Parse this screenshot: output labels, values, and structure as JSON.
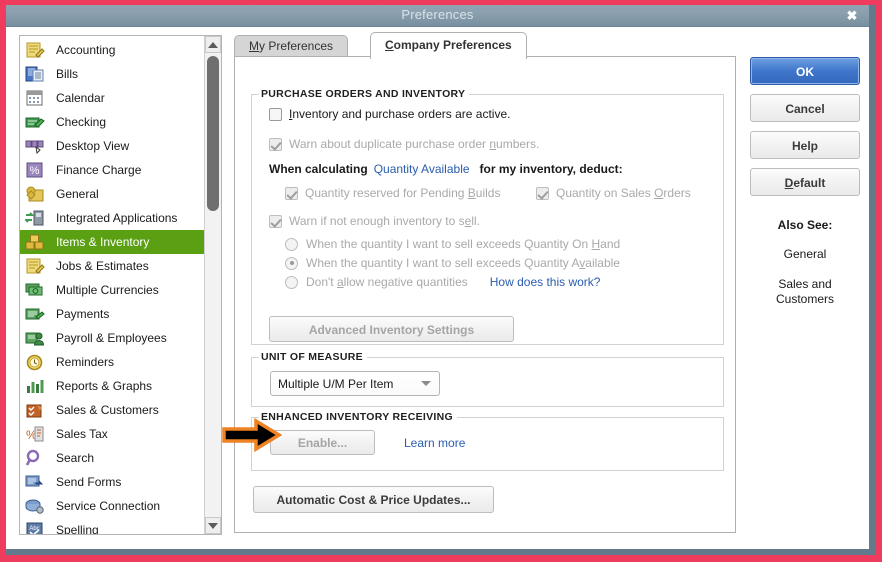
{
  "window": {
    "title": "Preferences",
    "close_label": "✖",
    "border_color": "#ef3b5e",
    "inner_border_color": "#63798c",
    "titlebar_color": "#8ba0af"
  },
  "sidebar": {
    "items": [
      {
        "label": "Accounting",
        "icon": "accounting-icon",
        "selected": false
      },
      {
        "label": "Bills",
        "icon": "bills-icon",
        "selected": false
      },
      {
        "label": "Calendar",
        "icon": "calendar-icon",
        "selected": false
      },
      {
        "label": "Checking",
        "icon": "checking-icon",
        "selected": false
      },
      {
        "label": "Desktop View",
        "icon": "desktop-view-icon",
        "selected": false
      },
      {
        "label": "Finance Charge",
        "icon": "finance-charge-icon",
        "selected": false
      },
      {
        "label": "General",
        "icon": "general-icon",
        "selected": false
      },
      {
        "label": "Integrated Applications",
        "icon": "integrated-applications-icon",
        "selected": false
      },
      {
        "label": "Items & Inventory",
        "icon": "items-inventory-icon",
        "selected": true
      },
      {
        "label": "Jobs & Estimates",
        "icon": "jobs-estimates-icon",
        "selected": false
      },
      {
        "label": "Multiple Currencies",
        "icon": "multiple-currencies-icon",
        "selected": false
      },
      {
        "label": "Payments",
        "icon": "payments-icon",
        "selected": false
      },
      {
        "label": "Payroll & Employees",
        "icon": "payroll-employees-icon",
        "selected": false
      },
      {
        "label": "Reminders",
        "icon": "reminders-icon",
        "selected": false
      },
      {
        "label": "Reports & Graphs",
        "icon": "reports-graphs-icon",
        "selected": false
      },
      {
        "label": "Sales & Customers",
        "icon": "sales-customers-icon",
        "selected": false
      },
      {
        "label": "Sales Tax",
        "icon": "sales-tax-icon",
        "selected": false
      },
      {
        "label": "Search",
        "icon": "search-icon",
        "selected": false
      },
      {
        "label": "Send Forms",
        "icon": "send-forms-icon",
        "selected": false
      },
      {
        "label": "Service Connection",
        "icon": "service-connection-icon",
        "selected": false
      },
      {
        "label": "Spelling",
        "icon": "spelling-icon",
        "selected": false
      }
    ],
    "selected_color": "#5aa012"
  },
  "tabs": [
    {
      "label": "My Preferences",
      "accel": "M",
      "active": false
    },
    {
      "label": "Company Preferences",
      "accel": "C",
      "active": true
    }
  ],
  "main": {
    "groups": {
      "purchase_orders": {
        "title": "PURCHASE ORDERS AND INVENTORY",
        "inventory_active": {
          "label": "Inventory and purchase orders are active.",
          "accel": "I",
          "checked": false,
          "disabled": false
        },
        "warn_duplicate_po": {
          "label": "Warn about duplicate purchase order numbers.",
          "accel": "n",
          "checked": true,
          "disabled": true
        },
        "when_calculating": {
          "prefix": "When calculating",
          "link": "Quantity Available",
          "suffix": "for my inventory, deduct:"
        },
        "deduct_pending_builds": {
          "label": "Quantity reserved for Pending Builds",
          "accel": "B",
          "checked": true,
          "disabled": true
        },
        "deduct_sales_orders": {
          "label": "Quantity on Sales Orders",
          "accel": "O",
          "checked": true,
          "disabled": true
        },
        "warn_not_enough": {
          "label": "Warn if not enough inventory to sell.",
          "accel": "e",
          "checked": true,
          "disabled": true
        },
        "radios": [
          {
            "label": "When the quantity I want to sell exceeds Quantity On Hand",
            "accel": "H",
            "selected": false,
            "disabled": true
          },
          {
            "label": "When the quantity I want to sell exceeds Quantity Available",
            "accel": "A",
            "selected": true,
            "disabled": true
          },
          {
            "label": "Don't allow negative quantities",
            "accel": "a",
            "selected": false,
            "disabled": true
          }
        ],
        "how_does_this_work": "How does this work?",
        "advanced_inventory_button": "Advanced Inventory Settings"
      },
      "unit_of_measure": {
        "title": "UNIT OF MEASURE",
        "selected_value": "Multiple U/M Per Item",
        "options": [
          "Multiple U/M Per Item"
        ]
      },
      "enhanced_inventory_receiving": {
        "title": "ENHANCED INVENTORY RECEIVING",
        "enable_button": "Enable...",
        "enable_disabled": true,
        "learn_more": "Learn more"
      }
    },
    "automatic_cost_button": "Automatic Cost & Price Updates..."
  },
  "right_panel": {
    "buttons": [
      {
        "label": "OK",
        "accel": "",
        "primary": true
      },
      {
        "label": "Cancel",
        "accel": "",
        "primary": false
      },
      {
        "label": "Help",
        "accel": "",
        "primary": false
      },
      {
        "label": "Default",
        "accel": "D",
        "primary": false
      }
    ],
    "also_see_title": "Also See:",
    "also_see_links": [
      "General",
      "Sales and Customers"
    ]
  },
  "annotation": {
    "arrow": "right-pointing-arrow",
    "fill": "#000000",
    "stroke": "#ef8223"
  }
}
